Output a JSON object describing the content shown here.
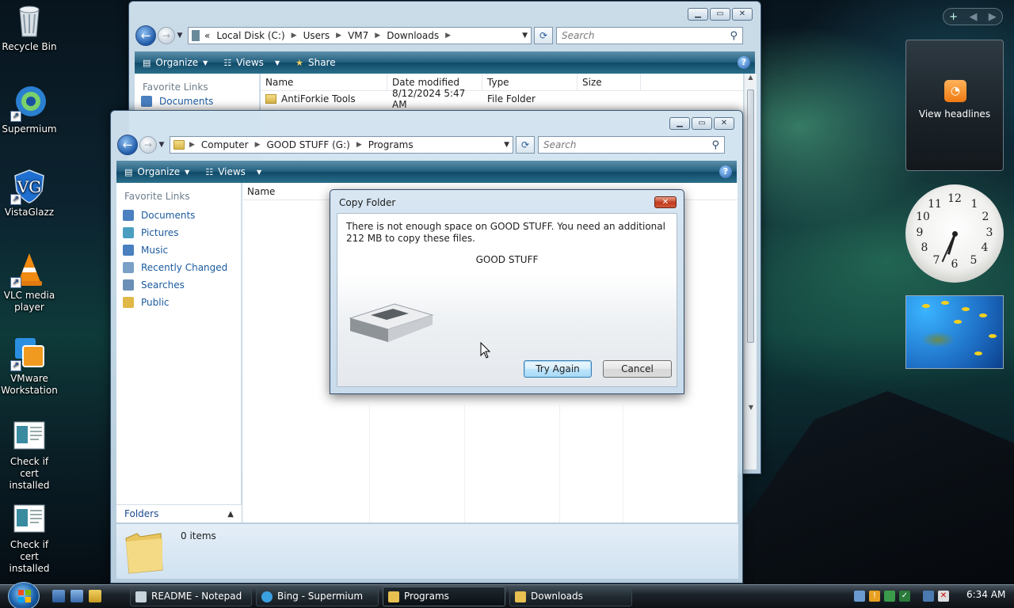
{
  "desktop": {
    "icons": [
      {
        "label": "Recycle Bin"
      },
      {
        "label": "Supermium"
      },
      {
        "label": "VistaGlazz"
      },
      {
        "label": "VLC media player"
      },
      {
        "label": "VMware Workstation"
      },
      {
        "label": "Check if cert installed"
      },
      {
        "label": "Check if cert installed"
      }
    ]
  },
  "back_window": {
    "breadcrumb": [
      "Local Disk (C:)",
      "Users",
      "VM7",
      "Downloads"
    ],
    "breadcrumb_prefix": "«",
    "search_placeholder": "Search",
    "toolbar": {
      "organize": "Organize",
      "views": "Views",
      "share": "Share"
    },
    "favorite_links_title": "Favorite Links",
    "favorite_first": "Documents",
    "columns": [
      "Name",
      "Date modified",
      "Type",
      "Size"
    ],
    "rows": [
      {
        "name": "AntiForkie Tools",
        "date": "8/12/2024 5:47 AM",
        "type": "File Folder",
        "size": ""
      }
    ]
  },
  "front_window": {
    "breadcrumb": [
      "Computer",
      "GOOD STUFF (G:)",
      "Programs"
    ],
    "search_placeholder": "Search",
    "toolbar": {
      "organize": "Organize",
      "views": "Views"
    },
    "favorite_links_title": "Favorite Links",
    "favorite_links": [
      {
        "label": "Documents",
        "color": "#4a7fc0"
      },
      {
        "label": "Pictures",
        "color": "#4a9fc0"
      },
      {
        "label": "Music",
        "color": "#4a7fc0"
      },
      {
        "label": "Recently Changed",
        "color": "#7aa0c8"
      },
      {
        "label": "Searches",
        "color": "#6a90b8"
      },
      {
        "label": "Public",
        "color": "#e0b848"
      }
    ],
    "column_name": "Name",
    "folders_label": "Folders",
    "status_items": "0 items"
  },
  "dialog": {
    "title": "Copy Folder",
    "message": "There is not enough space on GOOD STUFF. You need an additional 212 MB to copy these files.",
    "drive_name": "GOOD STUFF",
    "try_again": "Try Again",
    "cancel": "Cancel"
  },
  "gadgets": {
    "rss_label": "View headlines",
    "clock": {
      "hour": 6,
      "minute": 34
    }
  },
  "taskbar": {
    "items": [
      {
        "label": "README - Notepad",
        "active": false,
        "color": "#c8d4dc"
      },
      {
        "label": "Bing - Supermium",
        "active": false,
        "color": "#3aa0e0"
      },
      {
        "label": "Programs",
        "active": true,
        "color": "#e8c050"
      },
      {
        "label": "Downloads",
        "active": false,
        "color": "#e8c050"
      }
    ],
    "time": "6:34 AM"
  }
}
